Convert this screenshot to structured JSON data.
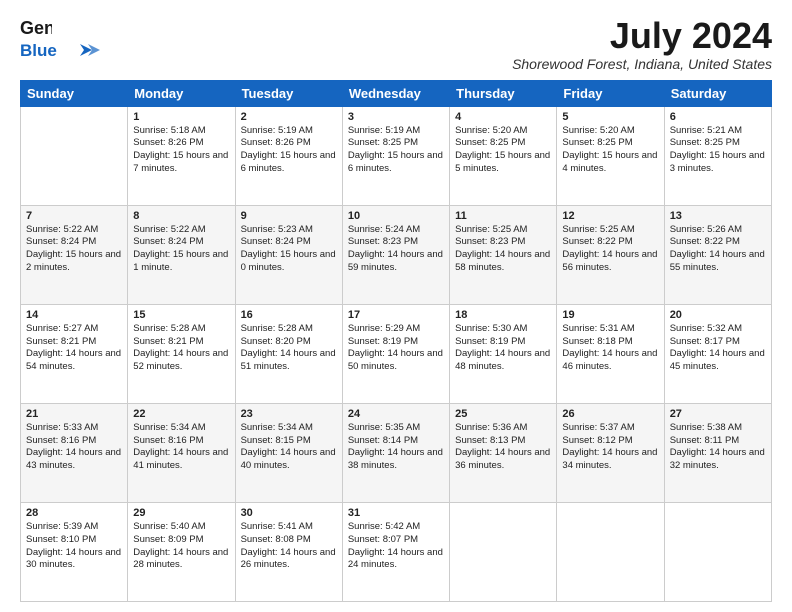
{
  "logo": {
    "line1": "General",
    "line2": "Blue"
  },
  "title": "July 2024",
  "location": "Shorewood Forest, Indiana, United States",
  "days_of_week": [
    "Sunday",
    "Monday",
    "Tuesday",
    "Wednesday",
    "Thursday",
    "Friday",
    "Saturday"
  ],
  "weeks": [
    [
      {
        "day": "",
        "sunrise": "",
        "sunset": "",
        "daylight": ""
      },
      {
        "day": "1",
        "sunrise": "Sunrise: 5:18 AM",
        "sunset": "Sunset: 8:26 PM",
        "daylight": "Daylight: 15 hours and 7 minutes."
      },
      {
        "day": "2",
        "sunrise": "Sunrise: 5:19 AM",
        "sunset": "Sunset: 8:26 PM",
        "daylight": "Daylight: 15 hours and 6 minutes."
      },
      {
        "day": "3",
        "sunrise": "Sunrise: 5:19 AM",
        "sunset": "Sunset: 8:25 PM",
        "daylight": "Daylight: 15 hours and 6 minutes."
      },
      {
        "day": "4",
        "sunrise": "Sunrise: 5:20 AM",
        "sunset": "Sunset: 8:25 PM",
        "daylight": "Daylight: 15 hours and 5 minutes."
      },
      {
        "day": "5",
        "sunrise": "Sunrise: 5:20 AM",
        "sunset": "Sunset: 8:25 PM",
        "daylight": "Daylight: 15 hours and 4 minutes."
      },
      {
        "day": "6",
        "sunrise": "Sunrise: 5:21 AM",
        "sunset": "Sunset: 8:25 PM",
        "daylight": "Daylight: 15 hours and 3 minutes."
      }
    ],
    [
      {
        "day": "7",
        "sunrise": "Sunrise: 5:22 AM",
        "sunset": "Sunset: 8:24 PM",
        "daylight": "Daylight: 15 hours and 2 minutes."
      },
      {
        "day": "8",
        "sunrise": "Sunrise: 5:22 AM",
        "sunset": "Sunset: 8:24 PM",
        "daylight": "Daylight: 15 hours and 1 minute."
      },
      {
        "day": "9",
        "sunrise": "Sunrise: 5:23 AM",
        "sunset": "Sunset: 8:24 PM",
        "daylight": "Daylight: 15 hours and 0 minutes."
      },
      {
        "day": "10",
        "sunrise": "Sunrise: 5:24 AM",
        "sunset": "Sunset: 8:23 PM",
        "daylight": "Daylight: 14 hours and 59 minutes."
      },
      {
        "day": "11",
        "sunrise": "Sunrise: 5:25 AM",
        "sunset": "Sunset: 8:23 PM",
        "daylight": "Daylight: 14 hours and 58 minutes."
      },
      {
        "day": "12",
        "sunrise": "Sunrise: 5:25 AM",
        "sunset": "Sunset: 8:22 PM",
        "daylight": "Daylight: 14 hours and 56 minutes."
      },
      {
        "day": "13",
        "sunrise": "Sunrise: 5:26 AM",
        "sunset": "Sunset: 8:22 PM",
        "daylight": "Daylight: 14 hours and 55 minutes."
      }
    ],
    [
      {
        "day": "14",
        "sunrise": "Sunrise: 5:27 AM",
        "sunset": "Sunset: 8:21 PM",
        "daylight": "Daylight: 14 hours and 54 minutes."
      },
      {
        "day": "15",
        "sunrise": "Sunrise: 5:28 AM",
        "sunset": "Sunset: 8:21 PM",
        "daylight": "Daylight: 14 hours and 52 minutes."
      },
      {
        "day": "16",
        "sunrise": "Sunrise: 5:28 AM",
        "sunset": "Sunset: 8:20 PM",
        "daylight": "Daylight: 14 hours and 51 minutes."
      },
      {
        "day": "17",
        "sunrise": "Sunrise: 5:29 AM",
        "sunset": "Sunset: 8:19 PM",
        "daylight": "Daylight: 14 hours and 50 minutes."
      },
      {
        "day": "18",
        "sunrise": "Sunrise: 5:30 AM",
        "sunset": "Sunset: 8:19 PM",
        "daylight": "Daylight: 14 hours and 48 minutes."
      },
      {
        "day": "19",
        "sunrise": "Sunrise: 5:31 AM",
        "sunset": "Sunset: 8:18 PM",
        "daylight": "Daylight: 14 hours and 46 minutes."
      },
      {
        "day": "20",
        "sunrise": "Sunrise: 5:32 AM",
        "sunset": "Sunset: 8:17 PM",
        "daylight": "Daylight: 14 hours and 45 minutes."
      }
    ],
    [
      {
        "day": "21",
        "sunrise": "Sunrise: 5:33 AM",
        "sunset": "Sunset: 8:16 PM",
        "daylight": "Daylight: 14 hours and 43 minutes."
      },
      {
        "day": "22",
        "sunrise": "Sunrise: 5:34 AM",
        "sunset": "Sunset: 8:16 PM",
        "daylight": "Daylight: 14 hours and 41 minutes."
      },
      {
        "day": "23",
        "sunrise": "Sunrise: 5:34 AM",
        "sunset": "Sunset: 8:15 PM",
        "daylight": "Daylight: 14 hours and 40 minutes."
      },
      {
        "day": "24",
        "sunrise": "Sunrise: 5:35 AM",
        "sunset": "Sunset: 8:14 PM",
        "daylight": "Daylight: 14 hours and 38 minutes."
      },
      {
        "day": "25",
        "sunrise": "Sunrise: 5:36 AM",
        "sunset": "Sunset: 8:13 PM",
        "daylight": "Daylight: 14 hours and 36 minutes."
      },
      {
        "day": "26",
        "sunrise": "Sunrise: 5:37 AM",
        "sunset": "Sunset: 8:12 PM",
        "daylight": "Daylight: 14 hours and 34 minutes."
      },
      {
        "day": "27",
        "sunrise": "Sunrise: 5:38 AM",
        "sunset": "Sunset: 8:11 PM",
        "daylight": "Daylight: 14 hours and 32 minutes."
      }
    ],
    [
      {
        "day": "28",
        "sunrise": "Sunrise: 5:39 AM",
        "sunset": "Sunset: 8:10 PM",
        "daylight": "Daylight: 14 hours and 30 minutes."
      },
      {
        "day": "29",
        "sunrise": "Sunrise: 5:40 AM",
        "sunset": "Sunset: 8:09 PM",
        "daylight": "Daylight: 14 hours and 28 minutes."
      },
      {
        "day": "30",
        "sunrise": "Sunrise: 5:41 AM",
        "sunset": "Sunset: 8:08 PM",
        "daylight": "Daylight: 14 hours and 26 minutes."
      },
      {
        "day": "31",
        "sunrise": "Sunrise: 5:42 AM",
        "sunset": "Sunset: 8:07 PM",
        "daylight": "Daylight: 14 hours and 24 minutes."
      },
      {
        "day": "",
        "sunrise": "",
        "sunset": "",
        "daylight": ""
      },
      {
        "day": "",
        "sunrise": "",
        "sunset": "",
        "daylight": ""
      },
      {
        "day": "",
        "sunrise": "",
        "sunset": "",
        "daylight": ""
      }
    ]
  ]
}
